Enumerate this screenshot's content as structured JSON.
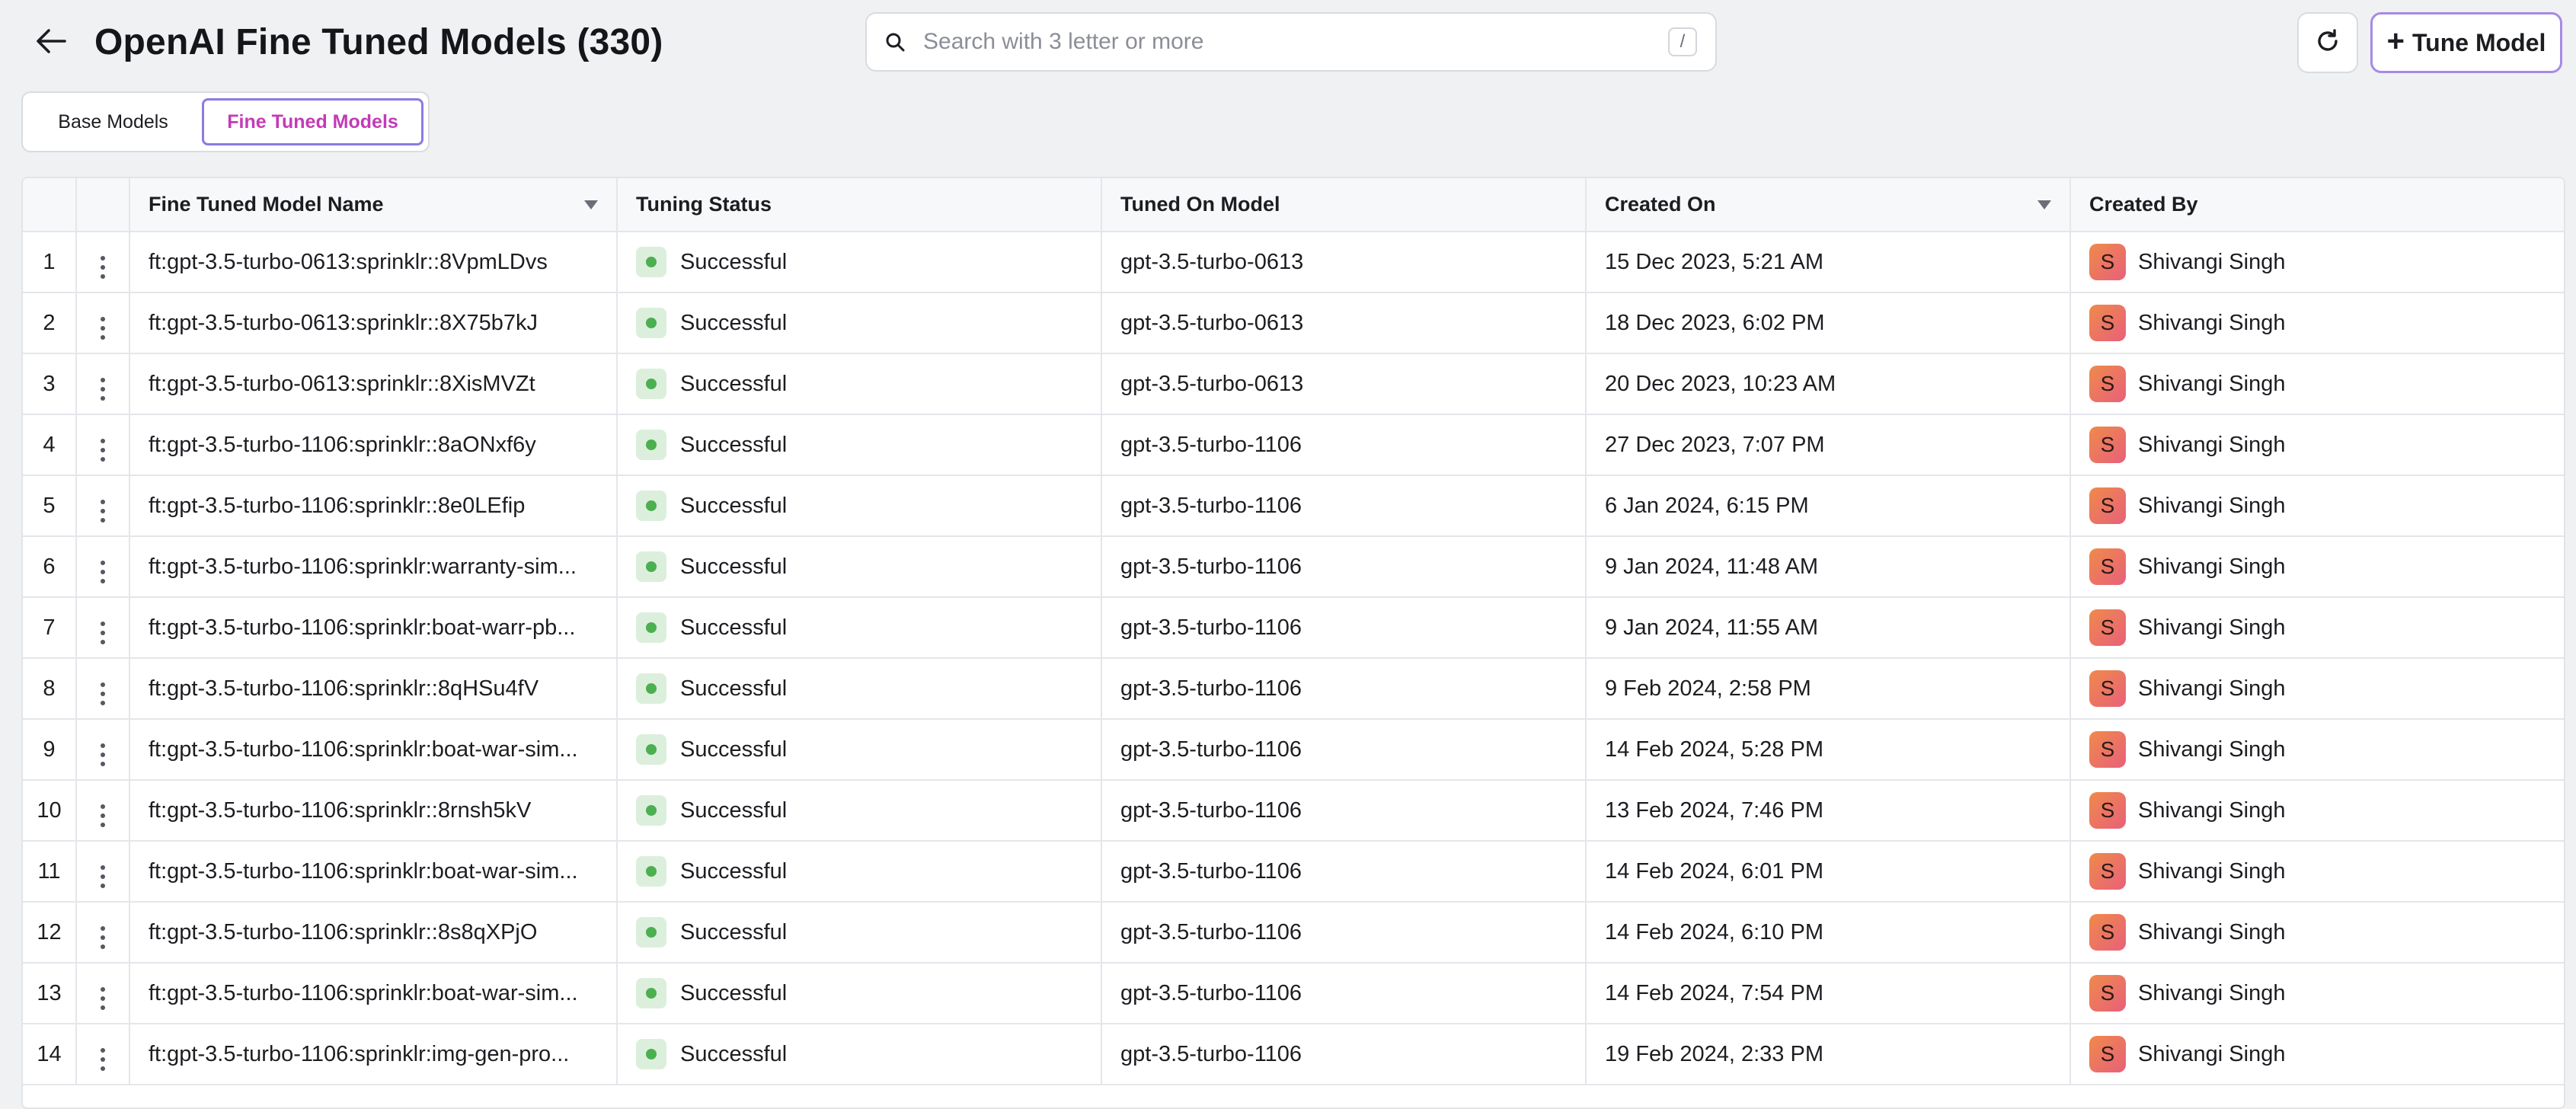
{
  "header": {
    "title": "OpenAI Fine Tuned Models (330)",
    "search_placeholder": "Search with 3 letter or more",
    "search_shortcut": "/",
    "tune_button_label": "Tune Model"
  },
  "tabs": [
    {
      "label": "Base Models",
      "active": false
    },
    {
      "label": "Fine Tuned Models",
      "active": true
    }
  ],
  "colors": {
    "accent": "#c43ab8",
    "status_success": "#4caf50"
  },
  "table": {
    "columns": [
      "Fine Tuned Model Name",
      "Tuning Status",
      "Tuned On Model",
      "Created On",
      "Created By"
    ],
    "rows": [
      {
        "idx": "1",
        "name": "ft:gpt-3.5-turbo-0613:sprinklr::8VpmLDvs",
        "status": "Successful",
        "model": "gpt-3.5-turbo-0613",
        "created": "15 Dec 2023, 5:21 AM",
        "avatar": "S",
        "by": "Shivangi Singh"
      },
      {
        "idx": "2",
        "name": "ft:gpt-3.5-turbo-0613:sprinklr::8X75b7kJ",
        "status": "Successful",
        "model": "gpt-3.5-turbo-0613",
        "created": "18 Dec 2023, 6:02 PM",
        "avatar": "S",
        "by": "Shivangi Singh"
      },
      {
        "idx": "3",
        "name": "ft:gpt-3.5-turbo-0613:sprinklr::8XisMVZt",
        "status": "Successful",
        "model": "gpt-3.5-turbo-0613",
        "created": "20 Dec 2023, 10:23 AM",
        "avatar": "S",
        "by": "Shivangi Singh"
      },
      {
        "idx": "4",
        "name": "ft:gpt-3.5-turbo-1106:sprinklr::8aONxf6y",
        "status": "Successful",
        "model": "gpt-3.5-turbo-1106",
        "created": "27 Dec 2023, 7:07 PM",
        "avatar": "S",
        "by": "Shivangi Singh"
      },
      {
        "idx": "5",
        "name": "ft:gpt-3.5-turbo-1106:sprinklr::8e0LEfip",
        "status": "Successful",
        "model": "gpt-3.5-turbo-1106",
        "created": "6 Jan 2024, 6:15 PM",
        "avatar": "S",
        "by": "Shivangi Singh"
      },
      {
        "idx": "6",
        "name": "ft:gpt-3.5-turbo-1106:sprinklr:warranty-sim...",
        "status": "Successful",
        "model": "gpt-3.5-turbo-1106",
        "created": "9 Jan 2024, 11:48 AM",
        "avatar": "S",
        "by": "Shivangi Singh"
      },
      {
        "idx": "7",
        "name": "ft:gpt-3.5-turbo-1106:sprinklr:boat-warr-pb...",
        "status": "Successful",
        "model": "gpt-3.5-turbo-1106",
        "created": "9 Jan 2024, 11:55 AM",
        "avatar": "S",
        "by": "Shivangi Singh"
      },
      {
        "idx": "8",
        "name": "ft:gpt-3.5-turbo-1106:sprinklr::8qHSu4fV",
        "status": "Successful",
        "model": "gpt-3.5-turbo-1106",
        "created": "9 Feb 2024, 2:58 PM",
        "avatar": "S",
        "by": "Shivangi Singh"
      },
      {
        "idx": "9",
        "name": "ft:gpt-3.5-turbo-1106:sprinklr:boat-war-sim...",
        "status": "Successful",
        "model": "gpt-3.5-turbo-1106",
        "created": "14 Feb 2024, 5:28 PM",
        "avatar": "S",
        "by": "Shivangi Singh"
      },
      {
        "idx": "10",
        "name": "ft:gpt-3.5-turbo-1106:sprinklr::8rnsh5kV",
        "status": "Successful",
        "model": "gpt-3.5-turbo-1106",
        "created": "13 Feb 2024, 7:46 PM",
        "avatar": "S",
        "by": "Shivangi Singh"
      },
      {
        "idx": "11",
        "name": "ft:gpt-3.5-turbo-1106:sprinklr:boat-war-sim...",
        "status": "Successful",
        "model": "gpt-3.5-turbo-1106",
        "created": "14 Feb 2024, 6:01 PM",
        "avatar": "S",
        "by": "Shivangi Singh"
      },
      {
        "idx": "12",
        "name": "ft:gpt-3.5-turbo-1106:sprinklr::8s8qXPjO",
        "status": "Successful",
        "model": "gpt-3.5-turbo-1106",
        "created": "14 Feb 2024, 6:10 PM",
        "avatar": "S",
        "by": "Shivangi Singh"
      },
      {
        "idx": "13",
        "name": "ft:gpt-3.5-turbo-1106:sprinklr:boat-war-sim...",
        "status": "Successful",
        "model": "gpt-3.5-turbo-1106",
        "created": "14 Feb 2024, 7:54 PM",
        "avatar": "S",
        "by": "Shivangi Singh"
      },
      {
        "idx": "14",
        "name": "ft:gpt-3.5-turbo-1106:sprinklr:img-gen-pro...",
        "status": "Successful",
        "model": "gpt-3.5-turbo-1106",
        "created": "19 Feb 2024, 2:33 PM",
        "avatar": "S",
        "by": "Shivangi Singh"
      }
    ]
  }
}
